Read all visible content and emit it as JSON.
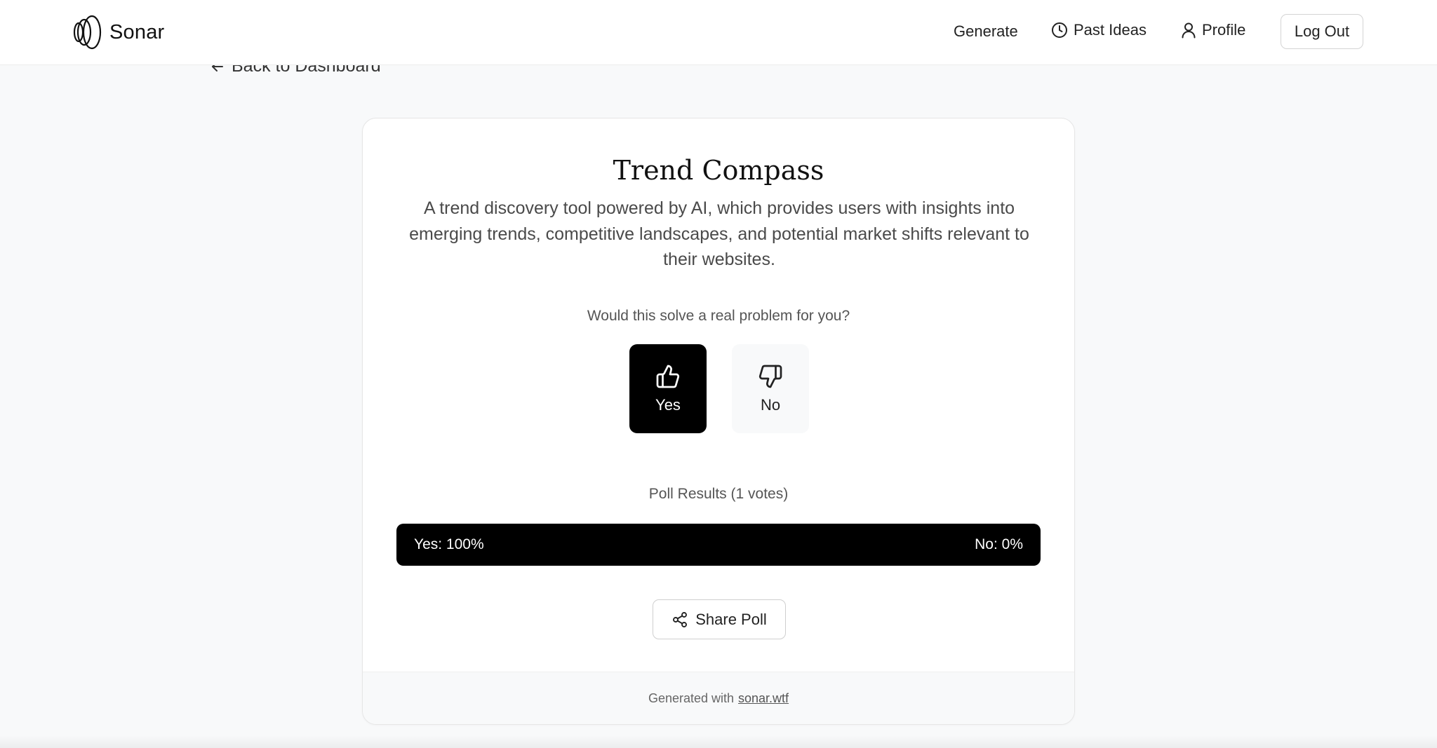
{
  "header": {
    "brand": "Sonar",
    "nav": {
      "generate": "Generate",
      "past_ideas": "Past Ideas",
      "profile": "Profile",
      "logout": "Log Out"
    }
  },
  "back_link": "Back to Dashboard",
  "idea": {
    "title": "Trend Compass",
    "description": "A trend discovery tool powered by AI, which provides users with insights into emerging trends, competitive landscapes, and potential market shifts relevant to their websites."
  },
  "poll": {
    "question": "Would this solve a real problem for you?",
    "yes_label": "Yes",
    "no_label": "No",
    "selected": "yes",
    "results_label": "Poll Results (1 votes)",
    "yes_result": "Yes: 100%",
    "no_result": "No: 0%",
    "yes_percent": 100,
    "share_label": "Share Poll"
  },
  "footer": {
    "prefix": "Generated with",
    "link_text": "sonar.wtf"
  },
  "icons": {
    "logo": "sonar-rings-logo-icon",
    "past_ideas": "clock-icon",
    "profile": "user-icon",
    "back": "arrow-left-icon",
    "yes": "thumbs-up-icon",
    "no": "thumbs-down-icon",
    "share": "share-icon"
  },
  "colors": {
    "accent": "#000000",
    "background": "#f8f9fa",
    "card": "#ffffff"
  }
}
